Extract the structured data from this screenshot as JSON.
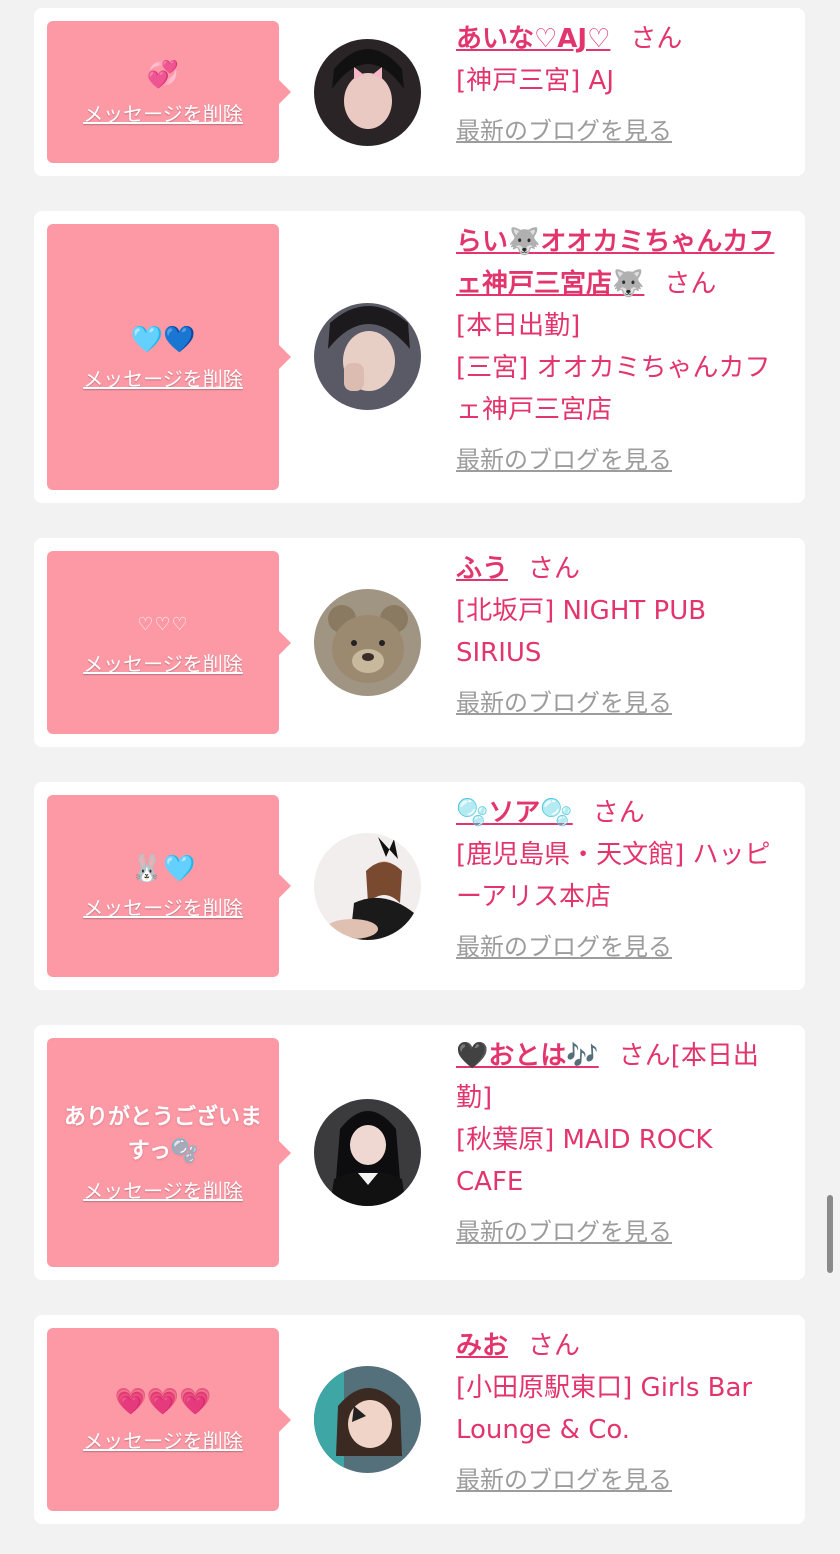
{
  "labels": {
    "delete_message": "メッセージを削除",
    "see_blog": "最新のブログを見る",
    "san": "さん"
  },
  "cards": [
    {
      "message": "💞",
      "name": "あいな♡AJ♡",
      "status": "",
      "shop": "[神戸三宮] AJ",
      "avatar_color": "#2a2426"
    },
    {
      "message": "🩵💙",
      "name": "らい🐺オオカミちゃんカフェ神戸三宮店🐺",
      "status": "[本日出勤]",
      "shop": "[三宮] オオカミちゃんカフェ神戸三宮店",
      "avatar_color": "#5a5a66"
    },
    {
      "message": "♡♡♡",
      "name": "ふう",
      "status": "",
      "shop": "[北坂戸] NIGHT PUB SIRIUS",
      "avatar_color": "#8b7a62"
    },
    {
      "message": "🐰🩵",
      "name": "🫧ソア🫧",
      "status": "",
      "shop": "[鹿児島県・天文館] ハッピーアリス本店",
      "avatar_color": "#e6dede"
    },
    {
      "message": "ありがとうございますっ🫧",
      "name": "🖤おとは🎶",
      "status": "[本日出勤]",
      "shop": "[秋葉原] MAID ROCK CAFE",
      "avatar_color": "#3b3b3e"
    },
    {
      "message": "💗💗💗",
      "name": "みお",
      "status": "",
      "shop": "[小田原駅東口] Girls Bar Lounge & Co.",
      "avatar_color": "#54707a"
    }
  ]
}
